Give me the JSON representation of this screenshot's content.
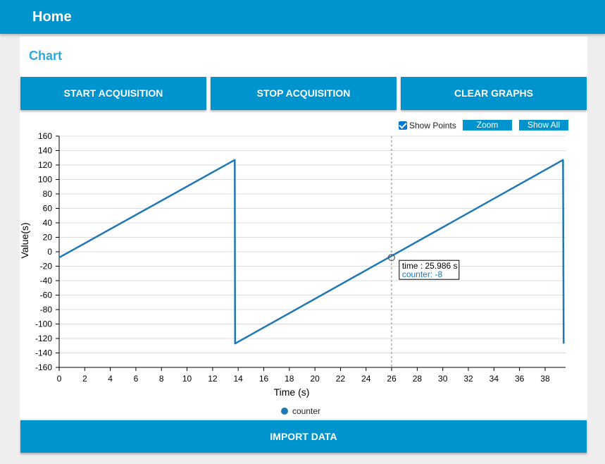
{
  "header": {
    "title": "Home"
  },
  "group": {
    "title": "Chart"
  },
  "buttons": {
    "start": "START ACQUISITION",
    "stop": "STOP ACQUISITION",
    "clear": "CLEAR GRAPHS",
    "import": "IMPORT DATA"
  },
  "controls": {
    "show_points_label": "Show Points",
    "show_points_checked": true,
    "zoom_label": "Zoom",
    "show_all_label": "Show All"
  },
  "tooltip": {
    "time_text": "time : 25.986 s",
    "series_text": "counter: -8",
    "time": 25.986,
    "value": -8
  },
  "colors": {
    "primary": "#0094ce",
    "series": "#1f77b4",
    "group_title": "#29a9e0"
  },
  "chart_data": {
    "type": "line",
    "xlabel": "Time (s)",
    "ylabel": "Value(s)",
    "xlim": [
      0,
      39.6
    ],
    "ylim": [
      -160,
      160
    ],
    "x_ticks": [
      0,
      2,
      4,
      6,
      8,
      10,
      12,
      14,
      16,
      18,
      20,
      22,
      24,
      26,
      28,
      30,
      32,
      34,
      36,
      38
    ],
    "y_ticks": [
      160,
      140,
      120,
      100,
      80,
      60,
      40,
      20,
      0,
      -20,
      -40,
      -60,
      -80,
      -100,
      -120,
      -140,
      -160
    ],
    "grid": true,
    "legend": "bottom-center",
    "series": [
      {
        "name": "counter",
        "points": [
          [
            0,
            -8
          ],
          [
            13.73,
            127
          ],
          [
            13.76,
            -127
          ],
          [
            39.4,
            127
          ],
          [
            39.45,
            -127
          ]
        ]
      }
    ]
  }
}
